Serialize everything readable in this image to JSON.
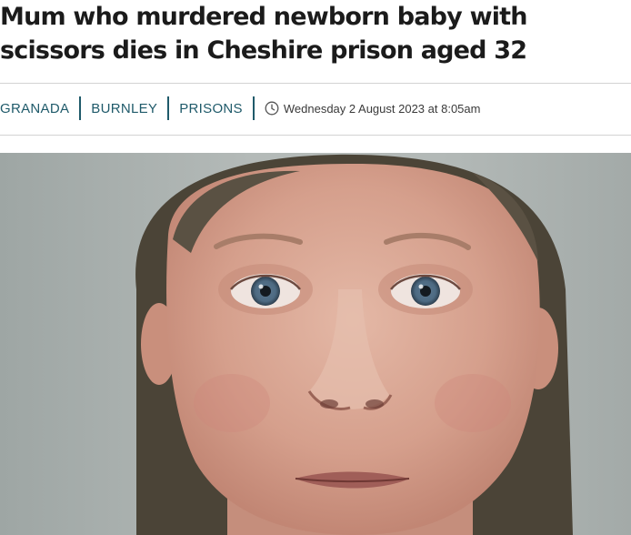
{
  "article": {
    "headline": "Mum who murdered newborn baby with scissors dies in Cheshire prison aged 32"
  },
  "tags": [
    {
      "label": "GRANADA",
      "icon": "none"
    },
    {
      "label": "BURNLEY"
    },
    {
      "label": "PRISONS"
    }
  ],
  "meta": {
    "date_icon": "clock-icon",
    "date": "Wednesday 2 August 2023 at 8:05am"
  },
  "image": {
    "subject": "portrait-photo",
    "accent_color": "#1f5a6a"
  }
}
